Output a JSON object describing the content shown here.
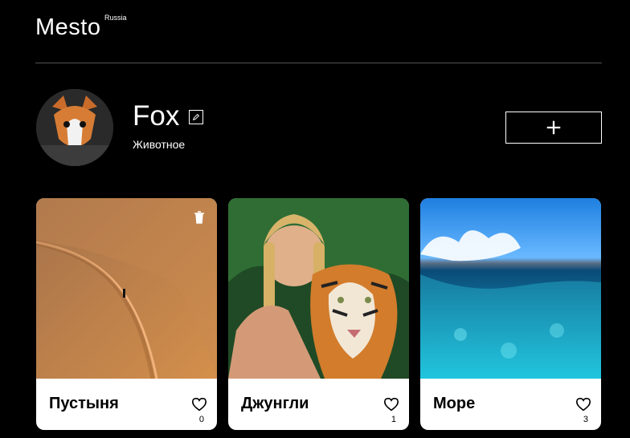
{
  "header": {
    "logo": "Mesto",
    "logo_sup": "Russia"
  },
  "profile": {
    "name": "Fox",
    "subtitle": "Животное"
  },
  "buttons": {
    "add_icon": "plus-icon",
    "edit_icon": "pencil-icon"
  },
  "cards": [
    {
      "title": "Пустыня",
      "likes": "0",
      "image": "desert"
    },
    {
      "title": "Джунгли",
      "likes": "1",
      "image": "jungle"
    },
    {
      "title": "Море",
      "likes": "3",
      "image": "sea"
    }
  ],
  "colors": {
    "bg": "#000000",
    "divider": "#545454",
    "card_bg": "#ffffff"
  }
}
